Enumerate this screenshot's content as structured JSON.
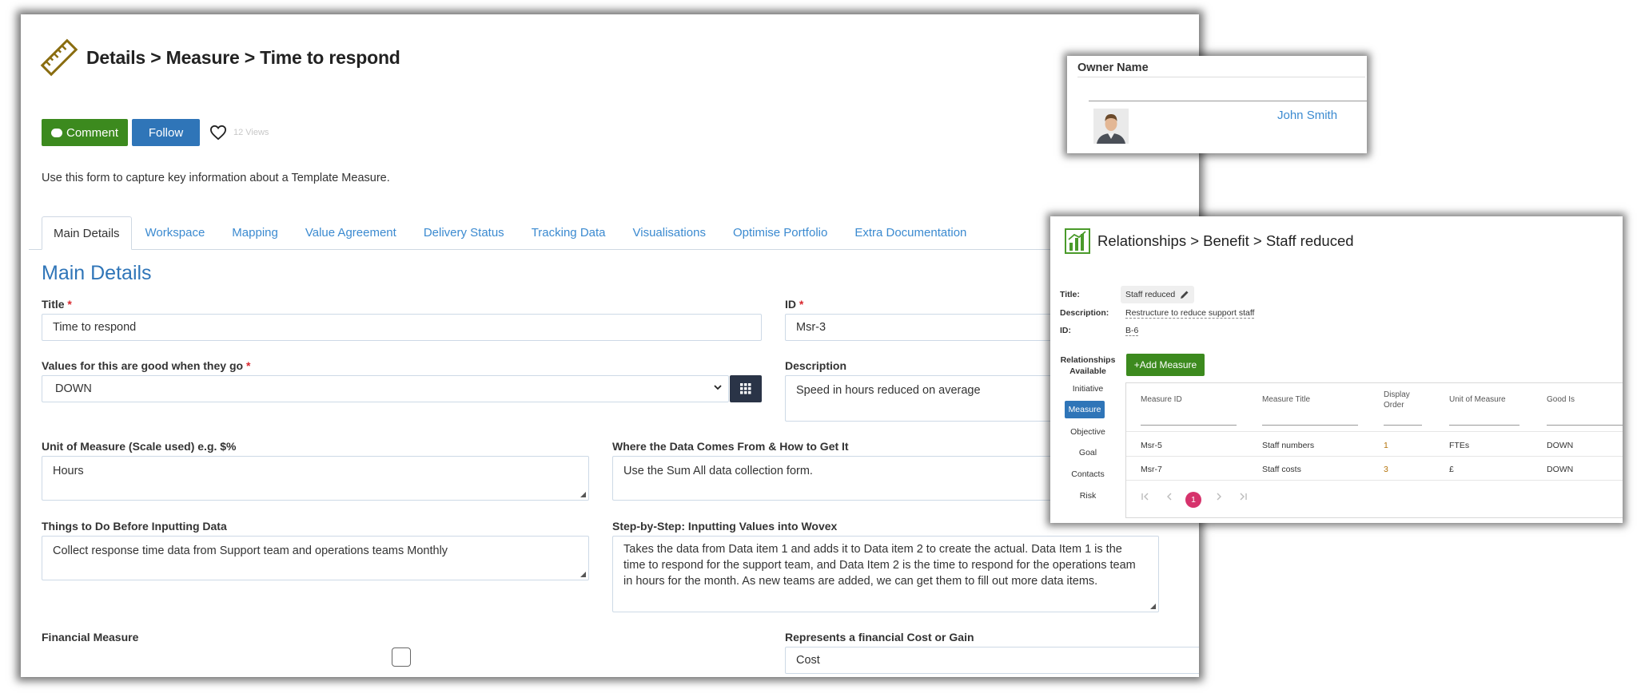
{
  "main": {
    "breadcrumb": "Details > Measure > Time to respond",
    "buttons": {
      "comment": "Comment",
      "follow": "Follow"
    },
    "views": "12 Views",
    "intro": "Use this form to capture key information about a Template Measure.",
    "tabs": [
      {
        "label": "Main Details",
        "active": true
      },
      {
        "label": "Workspace"
      },
      {
        "label": "Mapping"
      },
      {
        "label": "Value Agreement"
      },
      {
        "label": "Delivery Status"
      },
      {
        "label": "Tracking Data"
      },
      {
        "label": "Visualisations"
      },
      {
        "label": "Optimise Portfolio"
      },
      {
        "label": "Extra Documentation"
      }
    ],
    "section_title": "Main Details",
    "fields": {
      "title": {
        "label": "Title",
        "required": "*",
        "value": "Time to respond"
      },
      "id": {
        "label": "ID",
        "required": "*",
        "value": "Msr-3"
      },
      "good_when": {
        "label": "Values for this are good when they go",
        "required": "*",
        "value": "DOWN"
      },
      "description": {
        "label": "Description",
        "value": "Speed in hours reduced on average"
      },
      "unit": {
        "label": "Unit of Measure (Scale used) e.g. $%",
        "value": "Hours"
      },
      "data_source": {
        "label": "Where the Data Comes From & How to Get It",
        "value": "Use the Sum All data collection form."
      },
      "before_input": {
        "label": "Things to Do Before Inputting Data",
        "value": "Collect response time data from Support team and operations teams Monthly"
      },
      "steps": {
        "label": "Step-by-Step: Inputting Values into Wovex",
        "value": "Takes the data from Data item 1 and adds it to Data item 2 to create the actual.  Data Item 1 is the time to respond for the support team, and Data Item 2 is the time to respond for the operations team in hours for the month.  As new teams are added, we can get them to fill out more data items."
      },
      "financial": {
        "label": "Financial Measure",
        "checked": false
      },
      "cost_gain": {
        "label": "Represents a financial Cost or Gain",
        "value": "Cost"
      }
    }
  },
  "owner": {
    "title": "Owner Name",
    "name": "John Smith"
  },
  "relationships": {
    "breadcrumb": "Relationships > Benefit > Staff reduced",
    "labels": {
      "title": "Title:",
      "description": "Description:",
      "id": "ID:"
    },
    "title_value": "Staff reduced",
    "description_value": "Restructure to reduce support staff",
    "id_value": "B-6",
    "available_label": "Relationships Available",
    "items": [
      "Initiative",
      "Measure",
      "Objective",
      "Goal",
      "Contacts",
      "Risk"
    ],
    "active_item": "Measure",
    "add_button": "+Add Measure",
    "grid": {
      "headers": [
        "Measure ID",
        "Measure Title",
        "Display Order",
        "Unit of Measure",
        "Good Is"
      ],
      "rows": [
        [
          "Msr-5",
          "Staff numbers",
          "1",
          "FTEs",
          "DOWN"
        ],
        [
          "Msr-7",
          "Staff costs",
          "3",
          "£",
          "DOWN"
        ]
      ],
      "page": "1",
      "pager_icons": [
        "first-page-icon",
        "prev-page-icon",
        "next-page-icon",
        "last-page-icon"
      ]
    }
  },
  "colors": {
    "primary_green": "#3c8a1e",
    "primary_blue": "#2f75b8",
    "link_blue": "#3b8ad0",
    "required_red": "#d9272e",
    "page_pink": "#d6336c"
  }
}
